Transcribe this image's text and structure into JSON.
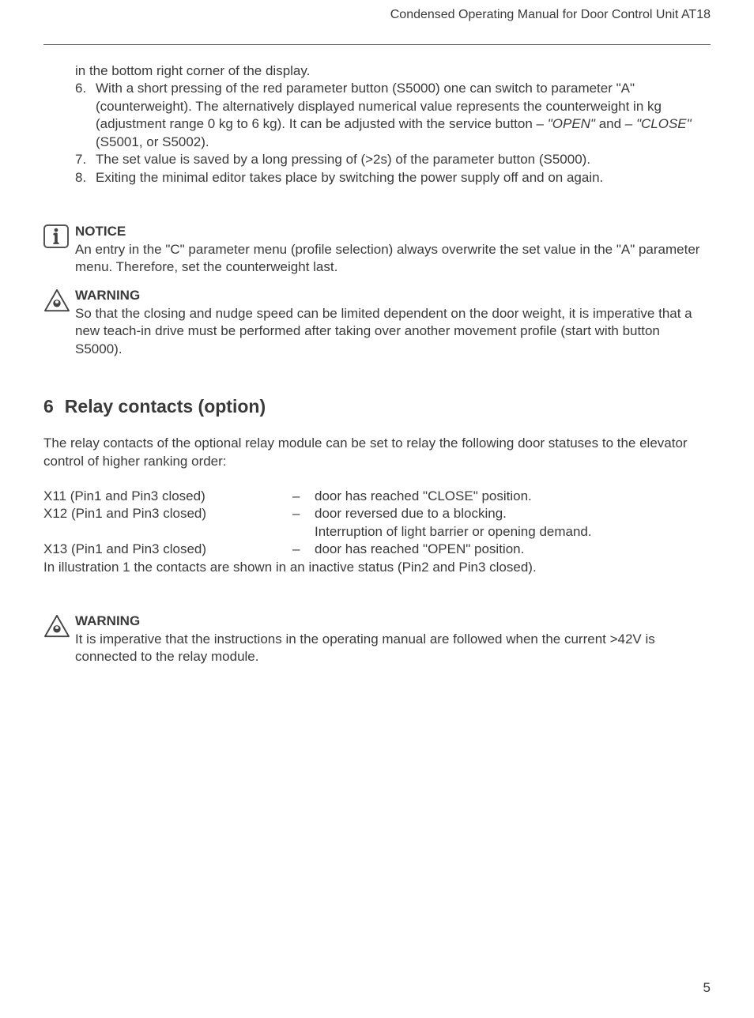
{
  "header": {
    "title": "Condensed Operating Manual for Door Control Unit AT18"
  },
  "intro_continued": "in the bottom right corner of the display.",
  "list": {
    "items": [
      {
        "num": "6.",
        "text_a": "With a short pressing of the red parameter button (S5000) one can switch to parameter \"A\" (counterweight). The alternatively displayed numerical value represents the counterweight in kg (adjustment range 0 kg to 6 kg). It can be adjusted with the service button – ",
        "em1": "\"OPEN\"",
        "mid": " and – ",
        "em2": "\"CLOSE\"",
        "text_b": " (S5001, or S5002)."
      },
      {
        "num": "7.",
        "text": "The set value is saved by a long pressing of (>2s) of the parameter button (S5000)."
      },
      {
        "num": "8.",
        "text": "Exiting the minimal editor takes place by switching the power supply off and on again."
      }
    ]
  },
  "notice": {
    "title": "NOTICE",
    "body": "An entry in the \"C\" parameter menu (profile selection) always overwrite the set value in the \"A\" parameter menu. Therefore, set the counterweight last."
  },
  "warning1": {
    "title": "WARNING",
    "body": "So that the closing and nudge speed can be limited dependent on the door weight, it is imperative that a new teach-in drive must be performed after taking over another movement profile (start with button S5000)."
  },
  "section": {
    "num": "6",
    "title": "Relay contacts (option)",
    "intro": "The relay contacts of the optional relay module can be set to relay the following door statuses to the elevator control of higher ranking order:",
    "rows": [
      {
        "left": "X11 (Pin1 and Pin3 closed)",
        "dash": "–",
        "right": "door has reached \"CLOSE\" position."
      },
      {
        "left": "X12 (Pin1 and Pin3 closed)",
        "dash": "–",
        "right": "door reversed due to a blocking."
      },
      {
        "left": "",
        "dash": "",
        "right": "Interruption of light barrier or opening demand."
      },
      {
        "left": "X13 (Pin1 and Pin3 closed)",
        "dash": "–",
        "right": "door has reached \"OPEN\" position."
      }
    ],
    "note": "In illustration 1 the contacts are shown in an inactive status (Pin2 and Pin3 closed)."
  },
  "warning2": {
    "title": "WARNING",
    "body": "It is imperative that the instructions in the operating manual are followed when the current >42V is connected to the relay module."
  },
  "page_number": "5"
}
